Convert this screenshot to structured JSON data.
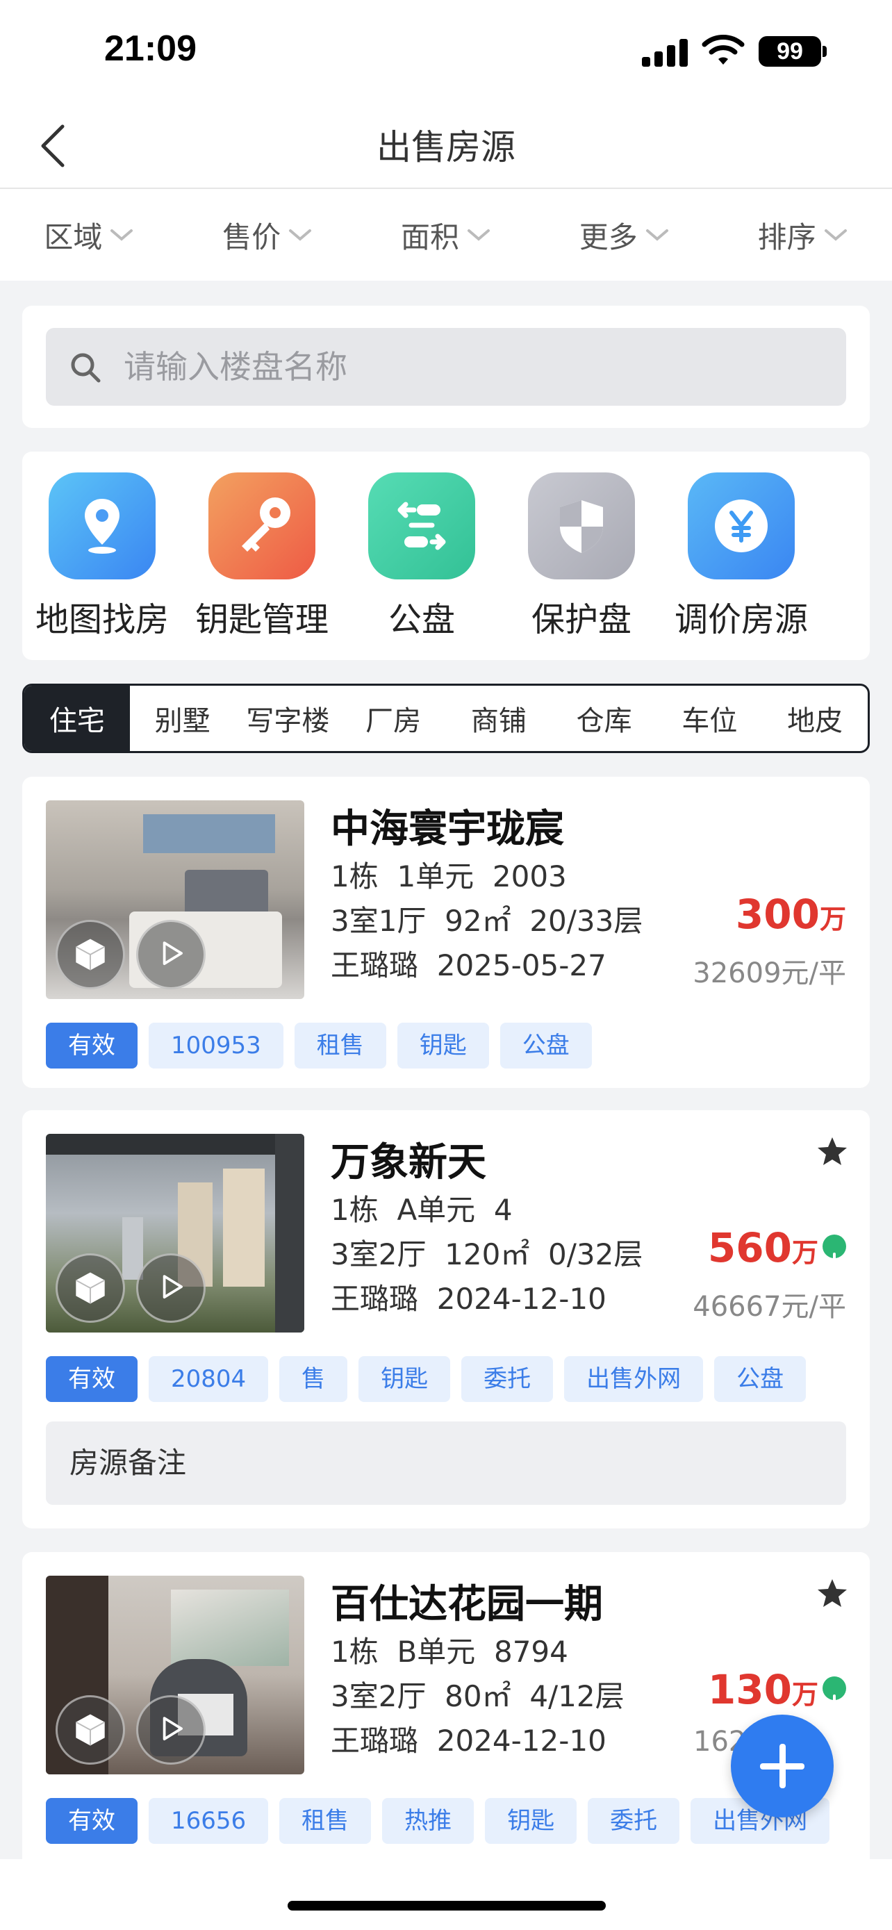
{
  "status": {
    "time": "21:09",
    "battery": "99"
  },
  "nav": {
    "title": "出售房源"
  },
  "filters": [
    "区域",
    "售价",
    "面积",
    "更多",
    "排序"
  ],
  "search": {
    "placeholder": "请输入楼盘名称"
  },
  "quick_actions": [
    {
      "label": "地图找房",
      "icon": "map-pin-icon",
      "color": "#4aa3f5"
    },
    {
      "label": "钥匙管理",
      "icon": "key-icon",
      "color": "#f0744a"
    },
    {
      "label": "公盘",
      "icon": "share-flow-icon",
      "color": "#3fcfa0"
    },
    {
      "label": "保护盘",
      "icon": "shield-icon",
      "color": "#b8b9c2"
    },
    {
      "label": "调价房源",
      "icon": "yen-icon",
      "color": "#3e9bf4"
    }
  ],
  "type_tabs": [
    "住宅",
    "别墅",
    "写字楼",
    "厂房",
    "商铺",
    "仓库",
    "车位",
    "地皮"
  ],
  "active_type_tab": "住宅",
  "listings": [
    {
      "name": "中海寰宇珑宸",
      "building": "1栋",
      "unit": "1单元",
      "room": "2003",
      "layout": "3室1厅",
      "area": "92㎡",
      "floor": "20/33层",
      "agent": "王璐璐",
      "date": "2025-05-27",
      "price": "300",
      "price_unit": "万",
      "unit_price": "32609元/平",
      "starred": false,
      "price_down": false,
      "tags": [
        "有效",
        "100953",
        "租售",
        "钥匙",
        "公盘"
      ]
    },
    {
      "name": "万象新天",
      "building": "1栋",
      "unit": "A单元",
      "room": "4",
      "layout": "3室2厅",
      "area": "120㎡",
      "floor": "0/32层",
      "agent": "王璐璐",
      "date": "2024-12-10",
      "price": "560",
      "price_unit": "万",
      "unit_price": "46667元/平",
      "starred": true,
      "price_down": true,
      "tags": [
        "有效",
        "20804",
        "售",
        "钥匙",
        "委托",
        "出售外网",
        "公盘"
      ],
      "remark": "房源备注"
    },
    {
      "name": "百仕达花园一期",
      "building": "1栋",
      "unit": "B单元",
      "room": "8794",
      "layout": "3室2厅",
      "area": "80㎡",
      "floor": "4/12层",
      "agent": "王璐璐",
      "date": "2024-12-10",
      "price": "130",
      "price_unit": "万",
      "unit_price": "162",
      "starred": true,
      "price_down": true,
      "tags": [
        "有效",
        "16656",
        "租售",
        "热推",
        "钥匙",
        "委托",
        "出售外网"
      ]
    }
  ]
}
